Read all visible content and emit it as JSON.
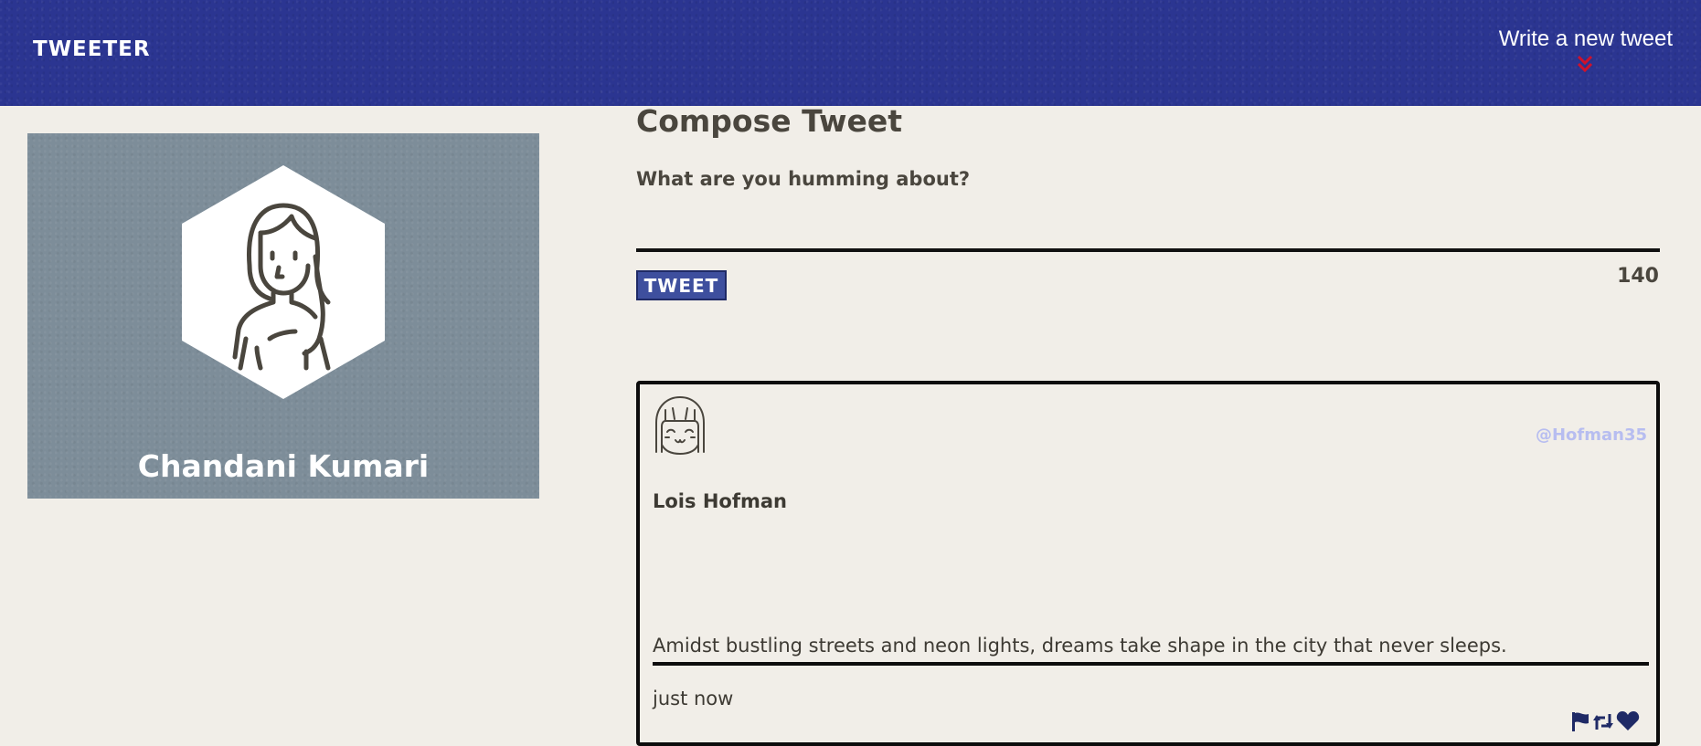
{
  "nav": {
    "brand": "TWEETER",
    "write_link": "Write a new tweet",
    "chevron_icon": "chevrons-down-icon",
    "chevron_color": "#d0112b"
  },
  "profile": {
    "name": "Chandani Kumari",
    "avatar_icon": "user-avatar-icon"
  },
  "compose": {
    "title": "Compose Tweet",
    "label": "What are you humming about?",
    "input_value": "",
    "button_label": "TWEET",
    "counter": "140"
  },
  "tweets": [
    {
      "avatar_icon": "smiling-face-avatar-icon",
      "handle": "@Hofman35",
      "author": "Lois Hofman",
      "text": "Amidst bustling streets and neon lights, dreams take shape in the city that never sleeps.",
      "time": "just now",
      "actions": [
        "flag-icon",
        "retweet-icon",
        "heart-icon"
      ]
    }
  ],
  "colors": {
    "header_bg": "#2b3591",
    "page_bg": "#f1eee8",
    "profile_bg": "#7d8d99",
    "button_bg": "#3e4f9e",
    "handle": "#b7bdf0",
    "action_icons": "#1f2a66"
  }
}
